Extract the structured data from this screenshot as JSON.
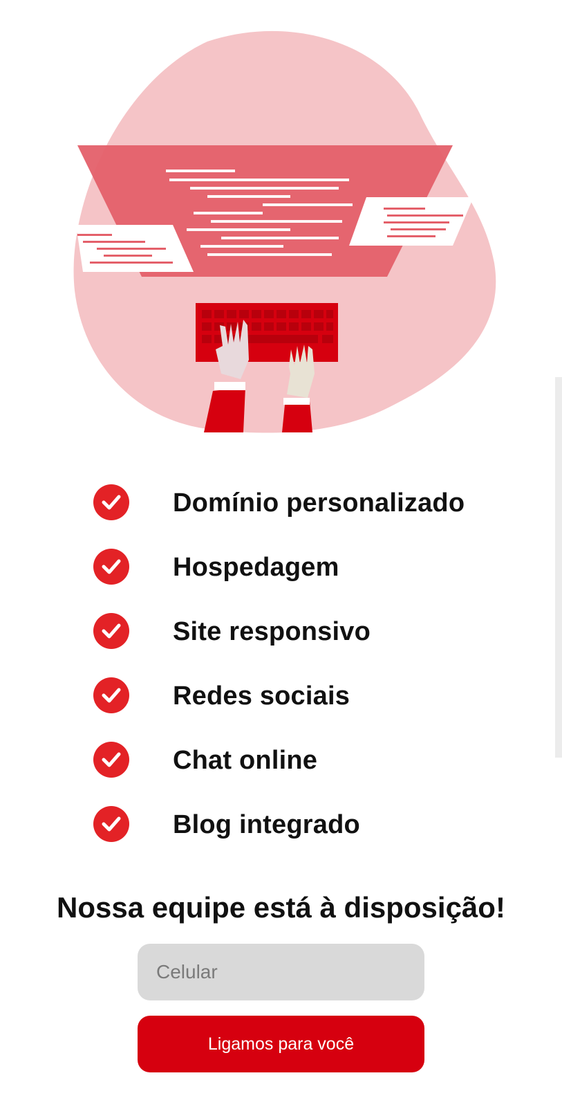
{
  "colors": {
    "accent": "#d6000f",
    "check": "#e32226",
    "blob": "#f5c4c7",
    "screen": "#e4606a",
    "input_bg": "#d9d9d9"
  },
  "hero": {
    "icon": "developer-typing-illustration"
  },
  "features": [
    {
      "label": "Domínio personalizado",
      "icon": "check-circle-icon"
    },
    {
      "label": "Hospedagem",
      "icon": "check-circle-icon"
    },
    {
      "label": "Site responsivo",
      "icon": "check-circle-icon"
    },
    {
      "label": "Redes sociais",
      "icon": "check-circle-icon"
    },
    {
      "label": "Chat online",
      "icon": "check-circle-icon"
    },
    {
      "label": "Blog integrado",
      "icon": "check-circle-icon"
    }
  ],
  "cta": {
    "title": "Nossa equipe está à disposição!",
    "phone_placeholder": "Celular",
    "phone_value": "",
    "button_label": "Ligamos para você"
  }
}
